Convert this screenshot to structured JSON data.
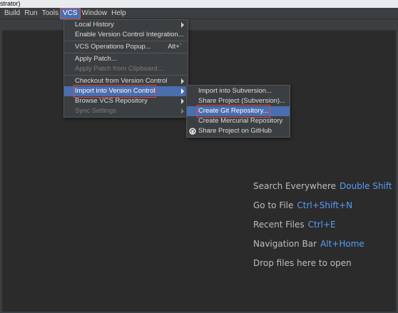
{
  "window": {
    "title_fragment": "strator)"
  },
  "menubar": {
    "items": [
      {
        "label": "Build",
        "id": "build"
      },
      {
        "label": "Run",
        "id": "run"
      },
      {
        "label": "Tools",
        "id": "tools"
      },
      {
        "label": "VCS",
        "id": "vcs",
        "active": true
      },
      {
        "label": "Window",
        "id": "window"
      },
      {
        "label": "Help",
        "id": "help"
      }
    ]
  },
  "vcs_menu": {
    "items": [
      {
        "label": "Local History",
        "submenu": true
      },
      {
        "label": "Enable Version Control Integration..."
      },
      {
        "separator": true
      },
      {
        "label": "VCS Operations Popup...",
        "shortcut": "Alt+`"
      },
      {
        "separator": true
      },
      {
        "label": "Apply Patch..."
      },
      {
        "label": "Apply Patch from Clipboard...",
        "disabled": true
      },
      {
        "separator": true
      },
      {
        "label": "Checkout from Version Control",
        "submenu": true
      },
      {
        "label": "Import into Version Control",
        "submenu": true,
        "highlighted": true
      },
      {
        "label": "Browse VCS Repository",
        "submenu": true
      },
      {
        "label": "Sync Settings",
        "submenu": true,
        "disabled": true
      }
    ]
  },
  "import_submenu": {
    "items": [
      {
        "label": "Import into Subversion..."
      },
      {
        "label": "Share Project (Subversion)..."
      },
      {
        "label": "Create Git Repository...",
        "selected": true
      },
      {
        "label": "Create Mercurial Repository"
      },
      {
        "label": "Share Project on GitHub",
        "icon": "github-icon"
      }
    ]
  },
  "welcome_hints": [
    {
      "text": "Search Everywhere",
      "key": "Double Shift"
    },
    {
      "text": "Go to File",
      "key": "Ctrl+Shift+N"
    },
    {
      "text": "Recent Files",
      "key": "Ctrl+E"
    },
    {
      "text": "Navigation Bar",
      "key": "Alt+Home"
    },
    {
      "text": "Drop files here to open",
      "key": ""
    }
  ],
  "colors": {
    "editor_bg": "#2b2b2b",
    "menu_bg": "#3c3f41",
    "selection": "#4b6eaf",
    "shortcut_blue": "#589df6",
    "annotation_red": "#e0474c"
  }
}
